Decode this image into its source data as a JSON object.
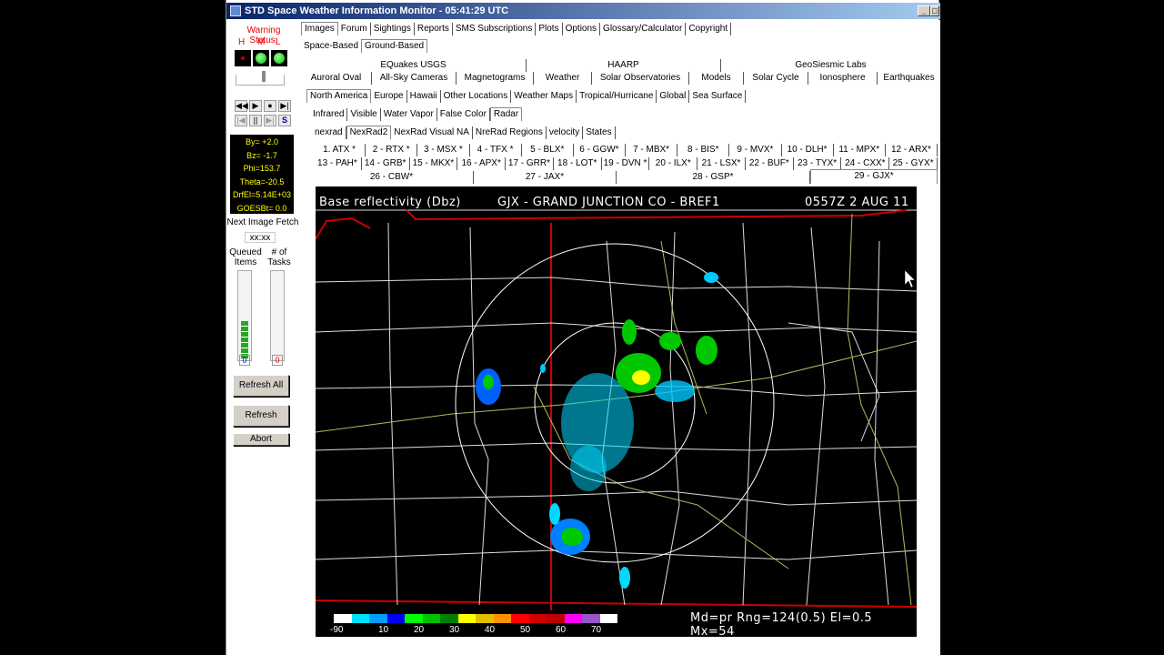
{
  "window": {
    "title": "STD Space Weather Information Monitor - 05:41:29 UTC"
  },
  "left": {
    "warning_label": "Warning Status:",
    "levels": [
      "H",
      "M",
      "L"
    ],
    "readout": [
      "By= +2.0",
      "Bz= -1.7",
      "Phi=153.7",
      "Theta=-20.5",
      "DrfEl=5.14E+03",
      "GOESBt= 0.0"
    ],
    "next_fetch_label": "Next Image Fetch",
    "next_fetch_value": "xx:xx",
    "queued_label": "Queued Items",
    "tasks_label": "# of Tasks",
    "queued_count": "0",
    "tasks_count": "0",
    "queued_level": 0.75,
    "buttons": {
      "refresh_all": "Refresh All",
      "refresh": "Refresh",
      "abort": "Abort"
    },
    "controls": {
      "s_label": "S"
    }
  },
  "menu": [
    "Images",
    "Forum",
    "Sightings",
    "Reports",
    "SMS Subscriptions",
    "Plots",
    "Options",
    "Glossary/Calculator",
    "Copyright"
  ],
  "subtabs": [
    "Space-Based",
    "Ground-Based"
  ],
  "groups": [
    "EQuakes USGS",
    "HAARP",
    "GeoSiesmic Labs"
  ],
  "categories": [
    "Auroral Oval",
    "All-Sky Cameras",
    "Magnetograms",
    "Weather",
    "Solar Observatories",
    "Models",
    "Solar Cycle",
    "Ionosphere",
    "Earthquakes"
  ],
  "regions": [
    "North America",
    "Europe",
    "Hawaii",
    "Other Locations",
    "Weather Maps",
    "Tropical/Hurricane",
    "Global",
    "Sea Surface"
  ],
  "layers": [
    "Infrared",
    "Visible",
    "Water Vapor",
    "False Color",
    "Radar"
  ],
  "radar_types": [
    "nexrad",
    "NexRad2",
    "NexRad Visual NA",
    "NreRad Regions",
    "velocity",
    "States"
  ],
  "stations_row1": [
    "1. ATX *",
    "2 - RTX *",
    "3 - MSX *",
    "4 - TFX *",
    "5 - BLX*",
    "6 - GGW*",
    "7 - MBX*",
    "8 - BIS*",
    "9 - MVX*",
    "10 - DLH*",
    "11 - MPX*",
    "12 - ARX*"
  ],
  "stations_row2": [
    "13 - PAH*",
    "14 - GRB*",
    "15 - MKX*",
    "16 - APX*",
    "17 - GRR*",
    "18 - LOT*",
    "19 - DVN *",
    "20 - ILX*",
    "21 - LSX*",
    "22 - BUF*",
    "23 - TYX*",
    "24 - CXX*",
    "25 - GYX*"
  ],
  "stations_row3": [
    "26 - CBW*",
    "27 - JAX*",
    "28 - GSP*",
    "29 - GJX*"
  ],
  "radar": {
    "header_left": "Base reflectivity (Dbz)",
    "header_mid": "GJX - GRAND JUNCTION CO - BREF1",
    "header_right": "0557Z  2 AUG 11",
    "footer": "Md=pr Rng=124(0.5) El=0.5 Mx=54",
    "scale_labels": [
      "-90",
      "10",
      "20",
      "30",
      "40",
      "50",
      "60",
      "70"
    ],
    "scale_colors": [
      "#ffffff",
      "#00e0ff",
      "#009cff",
      "#0000f0",
      "#00ff00",
      "#00c000",
      "#008000",
      "#ffff00",
      "#e0c000",
      "#ff9000",
      "#ff0000",
      "#d00000",
      "#c00000",
      "#ff00ff",
      "#9955c9",
      "#ffffff"
    ]
  }
}
